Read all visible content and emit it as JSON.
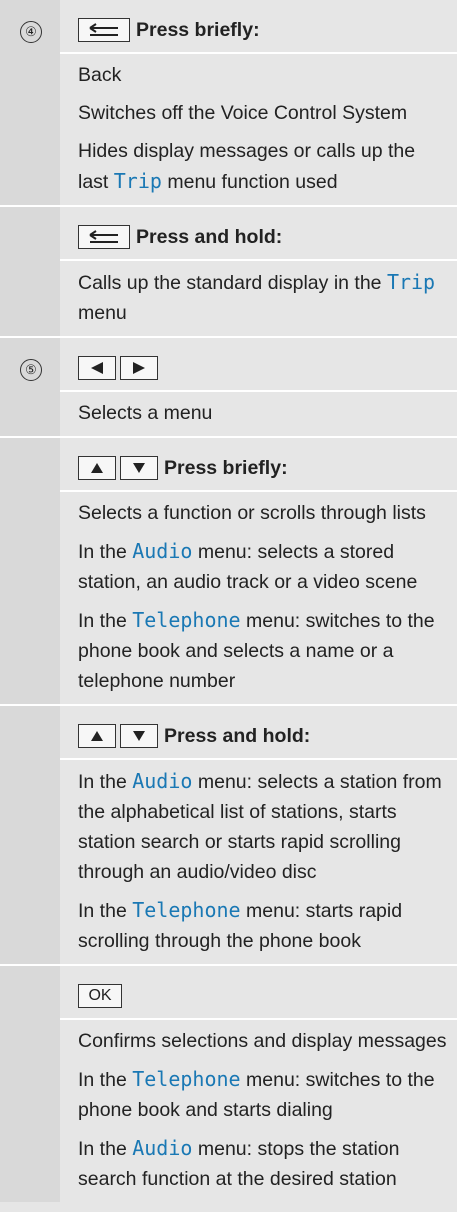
{
  "rows": {
    "r4": {
      "number": "④",
      "header_label": "Press briefly:",
      "lines": [
        "Back",
        "Switches off the Voice Control System",
        [
          "Hides display messages or calls up the last ",
          "Trip",
          " menu function used"
        ]
      ]
    },
    "r4b": {
      "header_label": "Press and hold:",
      "line": [
        "Calls up the standard display in the ",
        "Trip",
        " menu"
      ]
    },
    "r5": {
      "number": "⑤",
      "line": "Selects a menu"
    },
    "r5b": {
      "header_label": "Press briefly:",
      "l1": "Selects a function or scrolls through lists",
      "l2": [
        "In the ",
        "Audio",
        " menu: selects a stored station, an audio track or a video scene"
      ],
      "l3": [
        "In the ",
        "Telephone",
        " menu: switches to the phone book and selects a name or a telephone number"
      ]
    },
    "r5c": {
      "header_label": "Press and hold:",
      "l1": [
        "In the ",
        "Audio",
        " menu: selects a station from the alphabetical list of stations, starts station search or starts rapid scrolling through an audio/video disc"
      ],
      "l2": [
        "In the ",
        "Telephone",
        " menu: starts rapid scrolling through the phone book"
      ]
    },
    "r5d": {
      "ok_label": "OK",
      "l1": "Confirms selections and display messages",
      "l2": [
        "In the ",
        "Telephone",
        " menu: switches to the phone book and starts dialing"
      ],
      "l3": [
        "In the ",
        "Audio",
        " menu: stops the station search function at the desired station"
      ]
    }
  },
  "icons": {
    "back": "back-arrow-icon",
    "left": "left-triangle-icon",
    "right": "right-triangle-icon",
    "up": "up-triangle-icon",
    "down": "down-triangle-icon"
  },
  "colors": {
    "menu_name": "#1a78b4",
    "background": "#e6e6e6",
    "number_column": "#d9d9d9"
  }
}
